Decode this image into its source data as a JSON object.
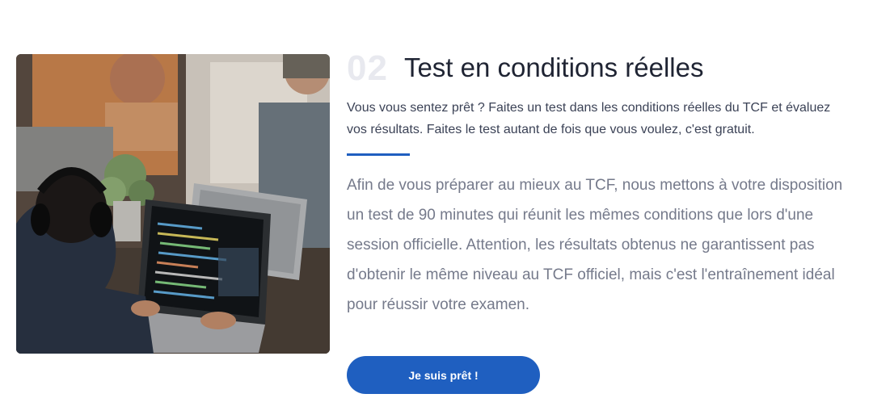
{
  "section": {
    "number": "02",
    "title": "Test en conditions réelles",
    "intro": "Vous vous sentez prêt ? Faites un test dans les conditions réelles du TCF et évaluez vos résultats. Faites le test autant de fois que vous voulez, c'est gratuit.",
    "body": "Afin de vous préparer au mieux au TCF, nous mettons à votre disposition un test de 90 minutes qui réunit les mêmes conditions que lors d'une session officielle. Attention, les résultats obtenus ne garantissent pas d'obtenir le même niveau au TCF officiel, mais c'est l'entraînement idéal pour réussir votre examen.",
    "cta_label": "Je suis prêt !"
  },
  "colors": {
    "accent": "#1f5fc0",
    "title": "#1f2433",
    "number": "#e8e9ef",
    "body": "#757a8b"
  }
}
